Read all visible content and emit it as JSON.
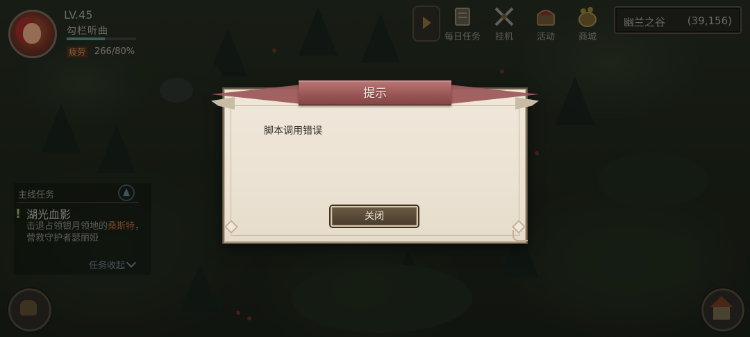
{
  "player": {
    "level": "LV.45",
    "name": "勾栏听曲",
    "fatigue_label": "疲劳",
    "fatigue_value": "266/80%"
  },
  "top_menu": {
    "items": [
      {
        "label": "每日任务",
        "icon": "book-scroll-icon"
      },
      {
        "label": "挂机",
        "icon": "crossed-swords-icon"
      },
      {
        "label": "活动",
        "icon": "treasure-icon"
      },
      {
        "label": "商城",
        "icon": "shop-bag-icon"
      }
    ]
  },
  "location": {
    "name": "幽兰之谷",
    "coords": "(39,156)"
  },
  "quest": {
    "header": "主线任务",
    "title": "湖光血影",
    "desc_prefix": "击退占领银月领地的",
    "desc_highlight": "桑斯特",
    "desc_suffix": "，营救守护者瑟丽娅",
    "collapse_label": "任务收起"
  },
  "dialog": {
    "title": "提示",
    "message": "脚本调用错误",
    "close_label": "关闭"
  }
}
